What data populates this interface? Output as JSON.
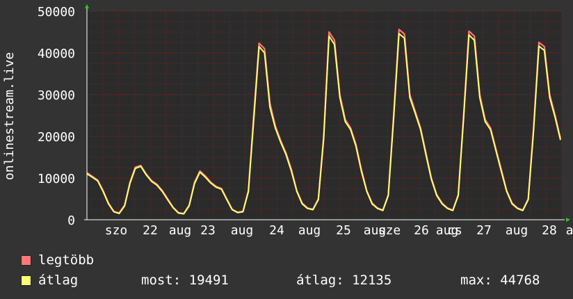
{
  "chart_data": {
    "type": "line",
    "ylabel": "onlinestream.live",
    "ylim": [
      0,
      50000
    ],
    "y_ticks": [
      "0",
      "10000",
      "20000",
      "30000",
      "40000",
      "50000"
    ],
    "x_tick_labels": [
      "szo",
      "22",
      "aug",
      "23",
      "aug",
      "24",
      "aug",
      "25",
      "aug",
      "sze",
      "26",
      "aug",
      "cs",
      "27",
      "aug",
      "28",
      "a"
    ],
    "grid": true,
    "colors": {
      "legtobb": "#ff7777",
      "atlag": "#ffff77",
      "grid": "#aa2222",
      "background": "#2b2b2b"
    },
    "series": [
      {
        "name": "legtöbb",
        "color": "#ff7777",
        "values": [
          11300,
          10400,
          9500,
          7000,
          4000,
          2000,
          1600,
          3500,
          9000,
          12600,
          13000,
          11000,
          9400,
          8500,
          7000,
          5000,
          3000,
          1700,
          1500,
          3500,
          9000,
          11700,
          10500,
          9000,
          8000,
          7500,
          5000,
          2500,
          1800,
          2000,
          7000,
          25000,
          42300,
          41000,
          28000,
          22500,
          19000,
          16000,
          12000,
          7000,
          4000,
          2800,
          2500,
          5000,
          20000,
          45000,
          43000,
          30000,
          24000,
          22000,
          18000,
          12000,
          7000,
          4000,
          2800,
          2300,
          6000,
          25000,
          45600,
          44500,
          30000,
          26000,
          22000,
          16000,
          10000,
          6000,
          4000,
          2800,
          2300,
          6000,
          25000,
          45200,
          44000,
          30000,
          24000,
          22000,
          17000,
          12000,
          7000,
          4000,
          2800,
          2300,
          5000,
          22000,
          42500,
          41500,
          30000,
          25000,
          19500
        ]
      },
      {
        "name": "átlag",
        "color": "#ffff77",
        "values": [
          11000,
          10200,
          9300,
          6800,
          3800,
          1900,
          1500,
          3300,
          8700,
          12300,
          12800,
          10800,
          9200,
          8300,
          6800,
          4800,
          2900,
          1600,
          1400,
          3300,
          8700,
          11400,
          10200,
          8800,
          7800,
          7300,
          4800,
          2400,
          1700,
          1900,
          6700,
          24000,
          41500,
          40000,
          27000,
          22000,
          18600,
          15600,
          11600,
          6800,
          3800,
          2700,
          2400,
          4800,
          19500,
          44000,
          42000,
          29300,
          23500,
          21600,
          17600,
          11600,
          6800,
          3800,
          2700,
          2200,
          5800,
          24300,
          44600,
          43500,
          29300,
          25500,
          21600,
          15600,
          9700,
          5800,
          3800,
          2700,
          2200,
          5800,
          24300,
          44300,
          43000,
          29300,
          23500,
          21600,
          16600,
          11600,
          6800,
          3800,
          2700,
          2200,
          4800,
          21300,
          41600,
          40600,
          29300,
          24500,
          19100
        ]
      }
    ]
  },
  "legend": {
    "items": [
      {
        "label": "legtöbb",
        "color": "#ff7777"
      },
      {
        "label": "átlag",
        "color": "#ffff77"
      }
    ]
  },
  "stats": {
    "most": "most: 19491",
    "atlag": "átlag: 12135",
    "max": "max: 44768"
  }
}
